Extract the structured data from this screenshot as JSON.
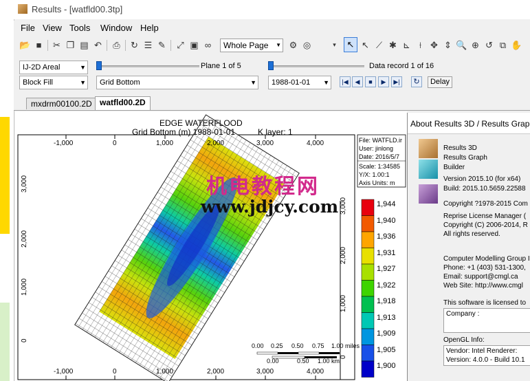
{
  "window": {
    "title": "Results - [watfld00.3tp]"
  },
  "menu": [
    "File",
    "View",
    "Tools",
    "Window",
    "Help"
  ],
  "toolbar": {
    "zoom_value": "Whole Page"
  },
  "controls": {
    "view_mode": "IJ-2D Areal",
    "fill_mode": "Block Fill",
    "property": "Grid Bottom",
    "plane_label": "Plane 1 of 5",
    "date_value": "1988-01-01",
    "record_label": "Data record 1 of 16",
    "delay_label": "Delay"
  },
  "tabs": [
    {
      "label": "mxdrm00100.2D",
      "active": false
    },
    {
      "label": "watfld00.2D",
      "active": true
    }
  ],
  "plot": {
    "title": "EDGE WATERFLOOD",
    "subtitle": "Grid Bottom (m) 1988-01-01",
    "layer": "K layer: 1",
    "x_ticks": [
      "-1,000",
      "0",
      "1,000",
      "2,000",
      "3,000",
      "4,000"
    ],
    "y_ticks": [
      "3,000",
      "2,000",
      "1,000",
      "0"
    ],
    "info": [
      "File: WATFLD.ir",
      "User: jinlong",
      "Date: 2016/5/7",
      "Scale: 1:34585",
      "Y/X: 1.00:1",
      "Axis Units: m"
    ],
    "legend_values": [
      "1,944",
      "1,940",
      "1,936",
      "1,931",
      "1,927",
      "1,922",
      "1,918",
      "1,913",
      "1,909",
      "1,905",
      "1,900"
    ],
    "legend_colors": [
      "#e8000e",
      "#f25a00",
      "#ffa500",
      "#e8e000",
      "#a8e000",
      "#3ed400",
      "#00c050",
      "#00c8b4",
      "#0096e0",
      "#1850e8",
      "#0000c8"
    ],
    "scale_miles": [
      "0.00",
      "0.25",
      "0.50",
      "0.75",
      "1.00 miles"
    ],
    "scale_km": [
      "0.00",
      "0.50",
      "1.00 km"
    ]
  },
  "watermark": {
    "chinese": "机电教程网",
    "url": "www.jdjcy.com"
  },
  "about": {
    "title": "About Results 3D / Results Grap",
    "products": [
      "Results 3D",
      "Results Graph",
      "Builder"
    ],
    "version": "Version 2015.10 (for x64)",
    "build": "Build: 2015.10.5659.22588",
    "copyright": "Copyright ?1978-2015 Com",
    "license_lines": [
      "Reprise License Manager (",
      "Copyright (C) 2006-2014, R",
      "All rights reserved."
    ],
    "contact_lines": [
      "Computer Modelling Group I",
      "Phone: +1 (403) 531-1300,",
      "Email: support@cmgl.ca",
      "Web Site: http://www.cmgl"
    ],
    "licensed_to": "This software is licensed to",
    "company_label": "Company :",
    "opengl_label": "OpenGL Info:",
    "vendor": "Vendor:  Intel     Renderer:",
    "gl_version": "Version:  4.0.0 - Build 10.1"
  }
}
